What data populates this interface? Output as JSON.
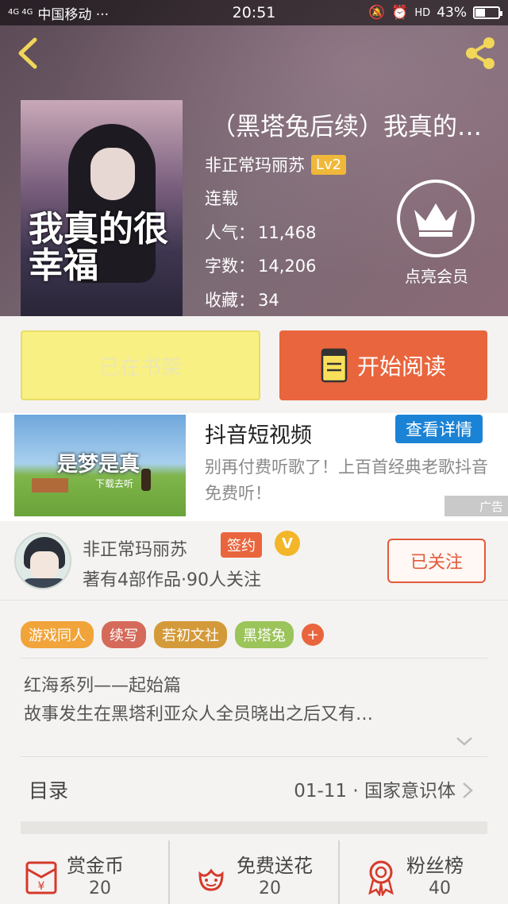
{
  "status_bar": {
    "carrier": "中国移动 ···",
    "network": "4G 4G",
    "time": "20:51",
    "hd": "HD",
    "battery": "43%",
    "battery_level": 0.43
  },
  "book": {
    "title": "（黑塔兔后续）我真的…",
    "author": "非正常玛丽苏",
    "level": "Lv2",
    "status": "连载",
    "popularity_label": "人气：",
    "popularity": "11,468",
    "words_label": "字数：",
    "words": "14,206",
    "favorites_label": "收藏：",
    "favorites": "34",
    "cover_text": "我真的很幸福"
  },
  "vip": {
    "label": "点亮会员"
  },
  "actions": {
    "shelf_label": "已在书架",
    "read_label": "开始阅读"
  },
  "ad": {
    "title": "抖音短视频",
    "detail_label": "查看详情",
    "description": "别再付费听歌了！上百首经典老歌抖音免费听！",
    "tag": "广告",
    "thumb_text": "是梦是真",
    "thumb_sub": "下载去听"
  },
  "author_card": {
    "name": "非正常玛丽苏",
    "sign_badge": "签约",
    "v_badge": "V",
    "stats": "著有4部作品·90人关注",
    "follow_label": "已关注"
  },
  "tags": [
    {
      "label": "游戏同人",
      "color": "#f1a43a"
    },
    {
      "label": "续写",
      "color": "#d56a5a"
    },
    {
      "label": "若初文社",
      "color": "#d49a3a"
    },
    {
      "label": "黑塔兔",
      "color": "#9bc45a"
    }
  ],
  "tag_plus": "+",
  "intro": {
    "line1": "红海系列——起始篇",
    "line2": "故事发生在黑塔利亚众人全员晓出之后又有…"
  },
  "catalog": {
    "label": "目录",
    "latest": "01-11 · 国家意识体"
  },
  "bottom": [
    {
      "label": "赏金币",
      "value": "20",
      "icon": "red-envelope-icon"
    },
    {
      "label": "免费送花",
      "value": "20",
      "icon": "flower-icon"
    },
    {
      "label": "粉丝榜",
      "value": "40",
      "icon": "medal-icon"
    }
  ],
  "colors": {
    "accent": "#e9653d",
    "shelf_button": "#f9f083",
    "ad_button": "#1b83d6"
  }
}
